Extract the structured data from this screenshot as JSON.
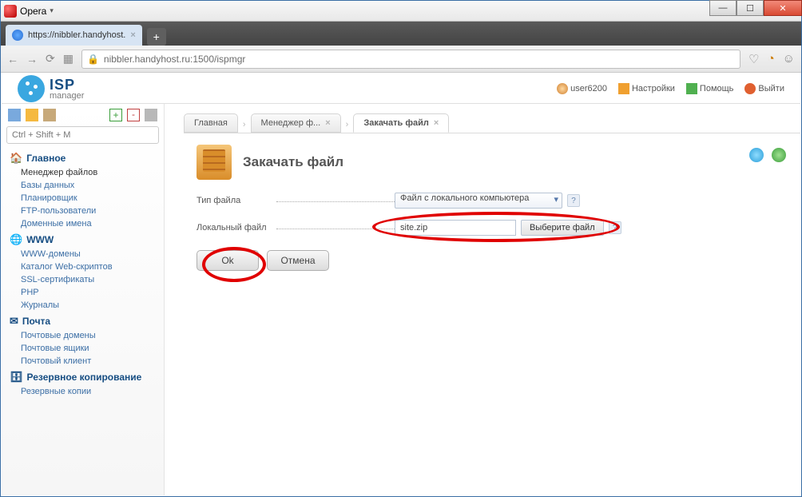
{
  "window": {
    "title": "Opera"
  },
  "browser_tab": {
    "label": "https://nibbler.handyhost."
  },
  "address": {
    "url": "nibbler.handyhost.ru:1500/ispmgr"
  },
  "logo": {
    "line1": "ISP",
    "line2": "manager"
  },
  "user_links": {
    "user": "user6200",
    "settings": "Настройки",
    "help": "Помощь",
    "exit": "Выйти"
  },
  "sidebar": {
    "search_placeholder": "Ctrl + Shift + M",
    "sections": [
      {
        "title": "Главное",
        "items": [
          "Менеджер файлов",
          "Базы данных",
          "Планировщик",
          "FTP-пользователи",
          "Доменные имена"
        ],
        "active": 0
      },
      {
        "title": "WWW",
        "items": [
          "WWW-домены",
          "Каталог Web-скриптов",
          "SSL-сертификаты",
          "PHP",
          "Журналы"
        ]
      },
      {
        "title": "Почта",
        "items": [
          "Почтовые домены",
          "Почтовые ящики",
          "Почтовый клиент"
        ]
      },
      {
        "title": "Резервное копирование",
        "items": [
          "Резервные копии"
        ]
      }
    ]
  },
  "tabs": {
    "t0": "Главная",
    "t1": "Менеджер ф...",
    "t2": "Закачать файл"
  },
  "panel": {
    "title": "Закачать файл",
    "row1_label": "Тип файла",
    "row1_value": "Файл с локального компьютера",
    "row2_label": "Локальный файл",
    "row2_value": "site.zip",
    "choose_btn": "Выберите файл",
    "ok": "Ok",
    "cancel": "Отмена"
  }
}
